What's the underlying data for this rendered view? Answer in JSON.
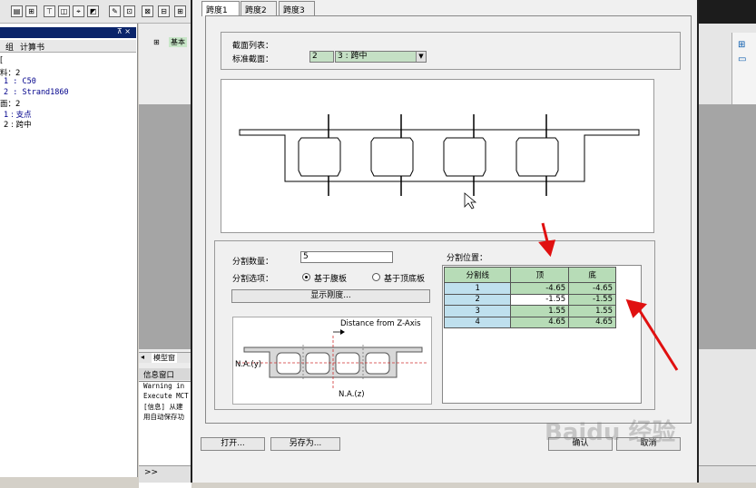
{
  "app": {
    "panel_tabs": [
      "组",
      "计算书"
    ],
    "panel_close": "⊼ ×",
    "tree": [
      {
        "text": "[",
        "cls": ""
      },
      {
        "text": "料：2",
        "cls": ""
      },
      {
        "text": "1 : C50",
        "cls": "blue mono"
      },
      {
        "text": "2 : Strand1860",
        "cls": "blue mono"
      },
      {
        "text": "面：2",
        "cls": ""
      },
      {
        "text": "1 : 支点",
        "cls": "blue"
      },
      {
        "text": "2 : 跨中",
        "cls": ""
      }
    ],
    "mid_label": "基本",
    "model_window_tab": "模型窗",
    "info_title": "信息窗口",
    "info_lines": [
      "Warning in",
      "Execute MCT",
      "[信息] 从建",
      "用自动保存功"
    ],
    "command_prompt": ">>"
  },
  "dialog": {
    "tabs": [
      "跨度1",
      "跨度2",
      "跨度3"
    ],
    "active_tab": 0,
    "section_list_label": "截面列表：",
    "standard_section_label": "标准截面：",
    "standard_section_value": "2",
    "standard_section_select": "3 : 跨中",
    "split_count_label": "分割数量：",
    "split_count_value": "5",
    "split_option_label": "分割选项：",
    "radio_web": "基于腹板",
    "radio_flange": "基于顶底板",
    "show_stiffness_button": "显示刚度...",
    "split_position_label": "分割位置：",
    "diagram_labels": {
      "distance": "Distance from Z-Axis",
      "na_y": "N.A.(y)",
      "na_z": "N.A.(z)"
    },
    "table": {
      "headers": [
        "分割线",
        "顶",
        "底"
      ],
      "rows": [
        {
          "id": "1",
          "top": "-4.65",
          "bottom": "-4.65"
        },
        {
          "id": "2",
          "top": "-1.55",
          "bottom": "-1.55"
        },
        {
          "id": "3",
          "top": "1.55",
          "bottom": "1.55"
        },
        {
          "id": "4",
          "top": "4.65",
          "bottom": "4.65"
        }
      ]
    },
    "buttons": {
      "open": "打开...",
      "save_as": "另存为...",
      "ok": "确认",
      "cancel": "取消"
    }
  },
  "watermark": "Baidu 经验",
  "colors": {
    "annotation_arrow": "#e01010",
    "table_header": "#b7dcb7",
    "row_header": "#bfe0ee"
  }
}
